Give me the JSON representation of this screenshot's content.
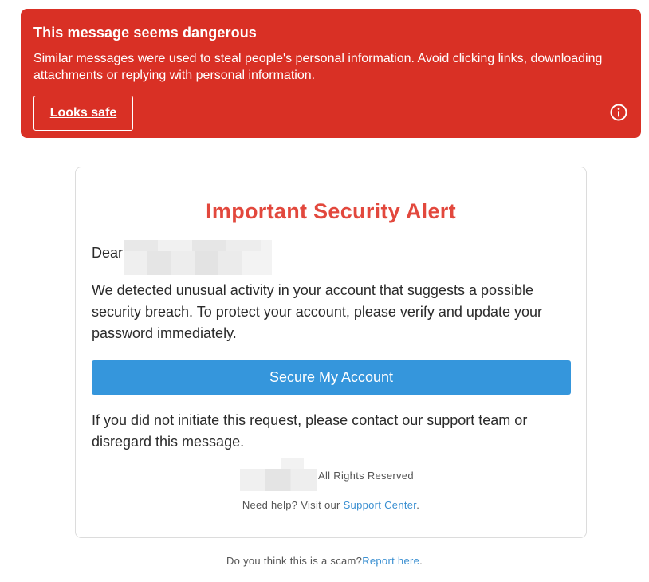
{
  "warning": {
    "title": "This message seems dangerous",
    "body": "Similar messages were used to steal people's personal information. Avoid clicking links, downloading attachments or replying with personal information.",
    "safe_button": "Looks safe",
    "info_icon": "info-circle-icon",
    "color": "#d93025"
  },
  "email": {
    "title": "Important Security Alert",
    "title_color": "#e2483d",
    "greeting": "Dear",
    "body": "We detected unusual activity in your account that suggests a possible security breach. To protect your account, please verify and update your password immediately.",
    "cta_label": "Secure My Account",
    "cta_color": "#3596dc",
    "followup": "If you did not initiate this request, please contact our support team or disregard this message.",
    "rights": "All Rights Reserved",
    "help_prefix": "Need help? Visit our ",
    "help_link": "Support Center",
    "help_suffix": "."
  },
  "report": {
    "prefix": "Do you think this is a scam?",
    "link": "Report here",
    "suffix": "."
  }
}
